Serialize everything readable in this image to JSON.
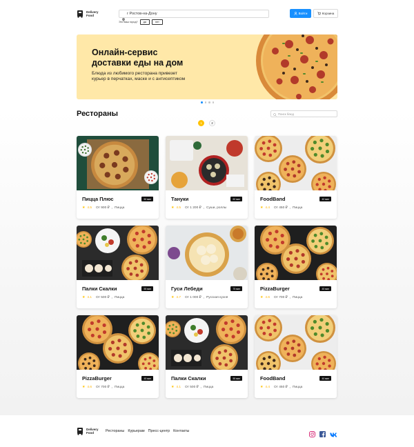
{
  "header": {
    "logo_text": "Delivery\nFood",
    "search_value": "г Ростов-на-Дону",
    "city_question": "Это ваш город?",
    "yes_label": "да",
    "no_label": "нет",
    "login_label": "Войти",
    "cart_label": "Корзина"
  },
  "promo": {
    "title": "Онлайн-сервис\nдоставки еды на дом",
    "text": "Блюда из любимого ресторана привезет\nкурьер в перчатках, маске и с антисептиком"
  },
  "restaurants": {
    "title": "Рестораны",
    "search_placeholder": "Поиск блюд",
    "pages": [
      "1",
      "2"
    ],
    "cards": [
      {
        "name": "Пицца Плюс",
        "time": "50 мин",
        "rating": "4.5",
        "price": "От 900 ₽",
        "category": "Пицца",
        "photo": "pizza-board"
      },
      {
        "name": "Тануки",
        "time": "60 мин",
        "rating": "4.5",
        "price": "От 1 200 ₽",
        "category": "Суши, роллы",
        "photo": "asian"
      },
      {
        "name": "FoodBand",
        "time": "40 мин",
        "rating": "4.4",
        "price": "От 450 ₽",
        "category": "Пицца",
        "photo": "pizzas"
      },
      {
        "name": "Палки Скалки",
        "time": "55 мин",
        "rating": "4.1",
        "price": "От 500 ₽",
        "category": "Пицца",
        "photo": "mixed"
      },
      {
        "name": "Гуси Лебеди",
        "time": "75 мин",
        "rating": "4.7",
        "price": "От 1 000 ₽",
        "category": "Русская кухня",
        "photo": "dumplings"
      },
      {
        "name": "PizzaBurger",
        "time": "45 мин",
        "rating": "4.6",
        "price": "От 700 ₽",
        "category": "Пицца",
        "photo": "pizza-dark"
      },
      {
        "name": "PizzaBurger",
        "time": "45 мин",
        "rating": "4.6",
        "price": "От 700 ₽",
        "category": "Пицца",
        "photo": "pizza-dark"
      },
      {
        "name": "Палки Скалки",
        "time": "55 мин",
        "rating": "4.1",
        "price": "От 500 ₽",
        "category": "Пицца",
        "photo": "mixed"
      },
      {
        "name": "FoodBand",
        "time": "40 мин",
        "rating": "4.4",
        "price": "От 450 ₽",
        "category": "Пицца",
        "photo": "pizzas"
      }
    ]
  },
  "footer": {
    "logo_text": "Delivery\nFood",
    "nav": [
      "Рестораны",
      "Курьерам",
      "Пресс-центр",
      "Контакты"
    ],
    "social_icons": [
      "instagram-icon",
      "facebook-icon",
      "vk-icon"
    ]
  },
  "colors": {
    "accent": "#1890ff",
    "star": "#ffc200",
    "promo_bg": "#ffe8a8"
  }
}
